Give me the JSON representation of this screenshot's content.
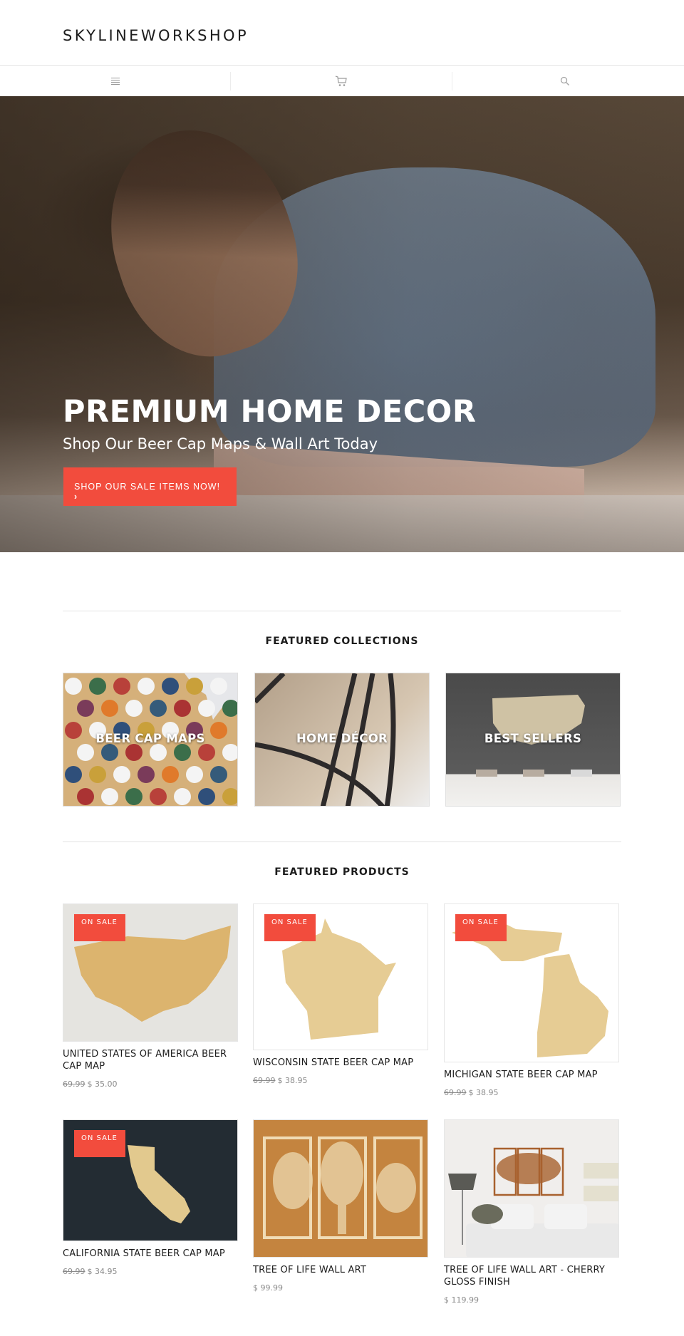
{
  "header": {
    "logo": "SKYLINEWORKSHOP"
  },
  "nav": {
    "items": [
      {
        "icon": "menu-icon",
        "label": "Menu"
      },
      {
        "icon": "cart-icon",
        "label": "Cart"
      },
      {
        "icon": "search-icon",
        "label": "Search"
      }
    ]
  },
  "hero": {
    "title": "PREMIUM HOME DECOR",
    "subtitle": "Shop Our Beer Cap Maps & Wall Art Today",
    "cta_label": "SHOP OUR SALE ITEMS NOW!",
    "cta_chevron": "›"
  },
  "colors": {
    "accent": "#f24c3d",
    "text": "#1c1c1c",
    "muted": "#8a8a8a",
    "divider": "#e2e2e2"
  },
  "featured_collections": {
    "title": "FEATURED COLLECTIONS",
    "items": [
      {
        "label": "BEER CAP MAPS"
      },
      {
        "label": "HOME DÉCOR"
      },
      {
        "label": "BEST SELLERS"
      }
    ]
  },
  "featured_products": {
    "title": "FEATURED PRODUCTS",
    "sale_badge": "ON SALE",
    "items": [
      {
        "name": "UNITED STATES OF AMERICA BEER CAP MAP",
        "compare_price": "69.99",
        "price": "$ 35.00",
        "on_sale": true
      },
      {
        "name": "WISCONSIN STATE BEER CAP MAP",
        "compare_price": "69.99",
        "price": "$ 38.95",
        "on_sale": true
      },
      {
        "name": "MICHIGAN STATE BEER CAP MAP",
        "compare_price": "69.99",
        "price": "$ 38.95",
        "on_sale": true
      },
      {
        "name": "CALIFORNIA STATE BEER CAP MAP",
        "compare_price": "69.99",
        "price": "$ 34.95",
        "on_sale": true
      },
      {
        "name": "TREE OF LIFE WALL ART",
        "compare_price": null,
        "price": "$ 99.99",
        "on_sale": false
      },
      {
        "name": "TREE OF LIFE WALL ART - CHERRY GLOSS FINISH",
        "compare_price": null,
        "price": "$ 119.99",
        "on_sale": false
      }
    ]
  }
}
